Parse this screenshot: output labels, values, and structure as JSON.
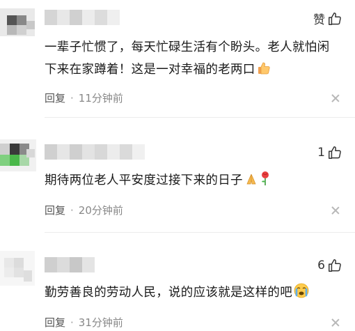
{
  "comments": [
    {
      "likes_label": "赞",
      "text": "一辈子忙惯了，每天忙碌生活有个盼头。老人就怕闲下来在家蹲着！这是一对幸福的老两口",
      "reply_label": "回复",
      "dot": "·",
      "time": "11分钟前",
      "emoji": "thumbs-up-emoji"
    },
    {
      "likes_label": "1",
      "text": "期待两位老人平安度过接下来的日子",
      "reply_label": "回复",
      "dot": "·",
      "time": "20分钟前",
      "emoji": "praying-hands-rose-emoji"
    },
    {
      "likes_label": "6",
      "text": "勤劳善良的劳动人民，说的应该就是这样的吧",
      "reply_label": "回复",
      "dot": "·",
      "time": "31分钟前",
      "emoji": "crying-face-emoji"
    }
  ],
  "colors": {
    "text": "#1a1a1a",
    "meta": "#888888",
    "divider": "#ececec"
  }
}
